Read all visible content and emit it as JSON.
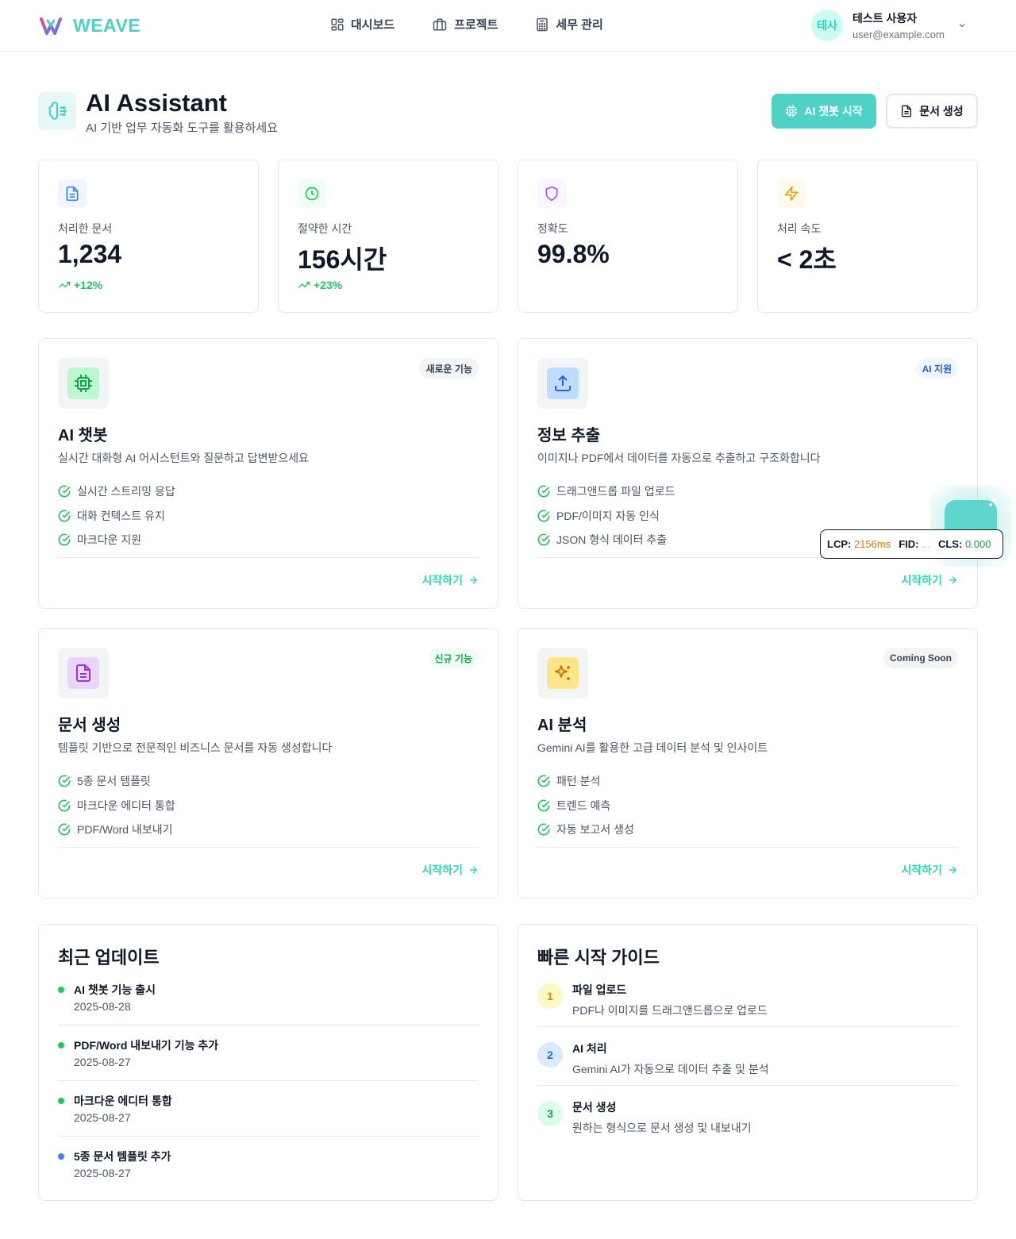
{
  "header": {
    "brand": "WEAVE",
    "nav": [
      {
        "label": "대시보드",
        "icon": "dashboard-icon"
      },
      {
        "label": "프로젝트",
        "icon": "briefcase-icon"
      },
      {
        "label": "세무 관리",
        "icon": "calculator-icon"
      }
    ],
    "user": {
      "initials": "테사",
      "name": "테스트 사용자",
      "email": "user@example.com"
    }
  },
  "page": {
    "title": "AI Assistant",
    "subtitle": "AI 기반 업무 자동화 도구를 활용하세요",
    "primary_button": "AI 챗봇 시작",
    "secondary_button": "문서 생성"
  },
  "stats": [
    {
      "label": "처리한 문서",
      "value": "1,234",
      "trend": "+12%",
      "icon": "document-icon",
      "color": "#3b82f6"
    },
    {
      "label": "절약한 시간",
      "value": "156시간",
      "trend": "+23%",
      "icon": "clock-icon",
      "color": "#22c55e"
    },
    {
      "label": "정확도",
      "value": "99.8%",
      "trend": "",
      "icon": "shield-icon",
      "color": "#a855f7"
    },
    {
      "label": "처리 속도",
      "value": "< 2초",
      "trend": "",
      "icon": "lightning-icon",
      "color": "#f59e0b"
    }
  ],
  "features": [
    {
      "title": "AI 챗봇",
      "desc": "실시간 대화형 AI 어시스턴트와 질문하고 답변받으세요",
      "badge": "새로운 기능",
      "items": [
        "실시간 스트리밍 응답",
        "대화 컨텍스트 유지",
        "마크다운 지원"
      ],
      "link": "시작하기",
      "icon": "chip-icon"
    },
    {
      "title": "정보 추출",
      "desc": "이미지나 PDF에서 데이터를 자동으로 추출하고 구조화합니다",
      "badge": "AI 지원",
      "items": [
        "드래그앤드롭 파일 업로드",
        "PDF/이미지 자동 인식",
        "JSON 형식 데이터 추출"
      ],
      "link": "시작하기",
      "icon": "upload-icon"
    },
    {
      "title": "문서 생성",
      "desc": "템플릿 기반으로 전문적인 비즈니스 문서를 자동 생성합니다",
      "badge": "신규 기능",
      "items": [
        "5종 문서 템플릿",
        "마크다운 에디터 통합",
        "PDF/Word 내보내기"
      ],
      "link": "시작하기",
      "icon": "document-icon"
    },
    {
      "title": "AI 분석",
      "desc": "Gemini AI를 활용한 고급 데이터 분석 및 인사이트",
      "badge": "Coming Soon",
      "items": [
        "패턴 분석",
        "트렌드 예측",
        "자동 보고서 생성"
      ],
      "link": "시작하기",
      "icon": "sparkles-icon"
    }
  ],
  "updates": {
    "title": "최근 업데이트",
    "items": [
      {
        "title": "AI 챗봇 기능 출시",
        "date": "2025-08-28",
        "color": "#22c55e"
      },
      {
        "title": "PDF/Word 내보내기 기능 추가",
        "date": "2025-08-27",
        "color": "#22c55e"
      },
      {
        "title": "마크다운 에디터 통합",
        "date": "2025-08-27",
        "color": "#22c55e"
      },
      {
        "title": "5종 문서 템플릿 추가",
        "date": "2025-08-27",
        "color": "#3b82f6"
      }
    ]
  },
  "guide": {
    "title": "빠른 시작 가이드",
    "steps": [
      {
        "num": "1",
        "title": "파일 업로드",
        "desc": "PDF나 이미지를 드래그앤드롭으로 업로드"
      },
      {
        "num": "2",
        "title": "AI 처리",
        "desc": "Gemini AI가 자동으로 데이터 추출 및 분석"
      },
      {
        "num": "3",
        "title": "문서 생성",
        "desc": "원하는 형식으로 문서 생성 및 내보내기"
      }
    ]
  },
  "vitals": {
    "lcp_label": "LCP:",
    "lcp_value": "2156ms",
    "fid_label": "FID:",
    "fid_value": "...",
    "cls_label": "CLS:",
    "cls_value": "0.000"
  }
}
